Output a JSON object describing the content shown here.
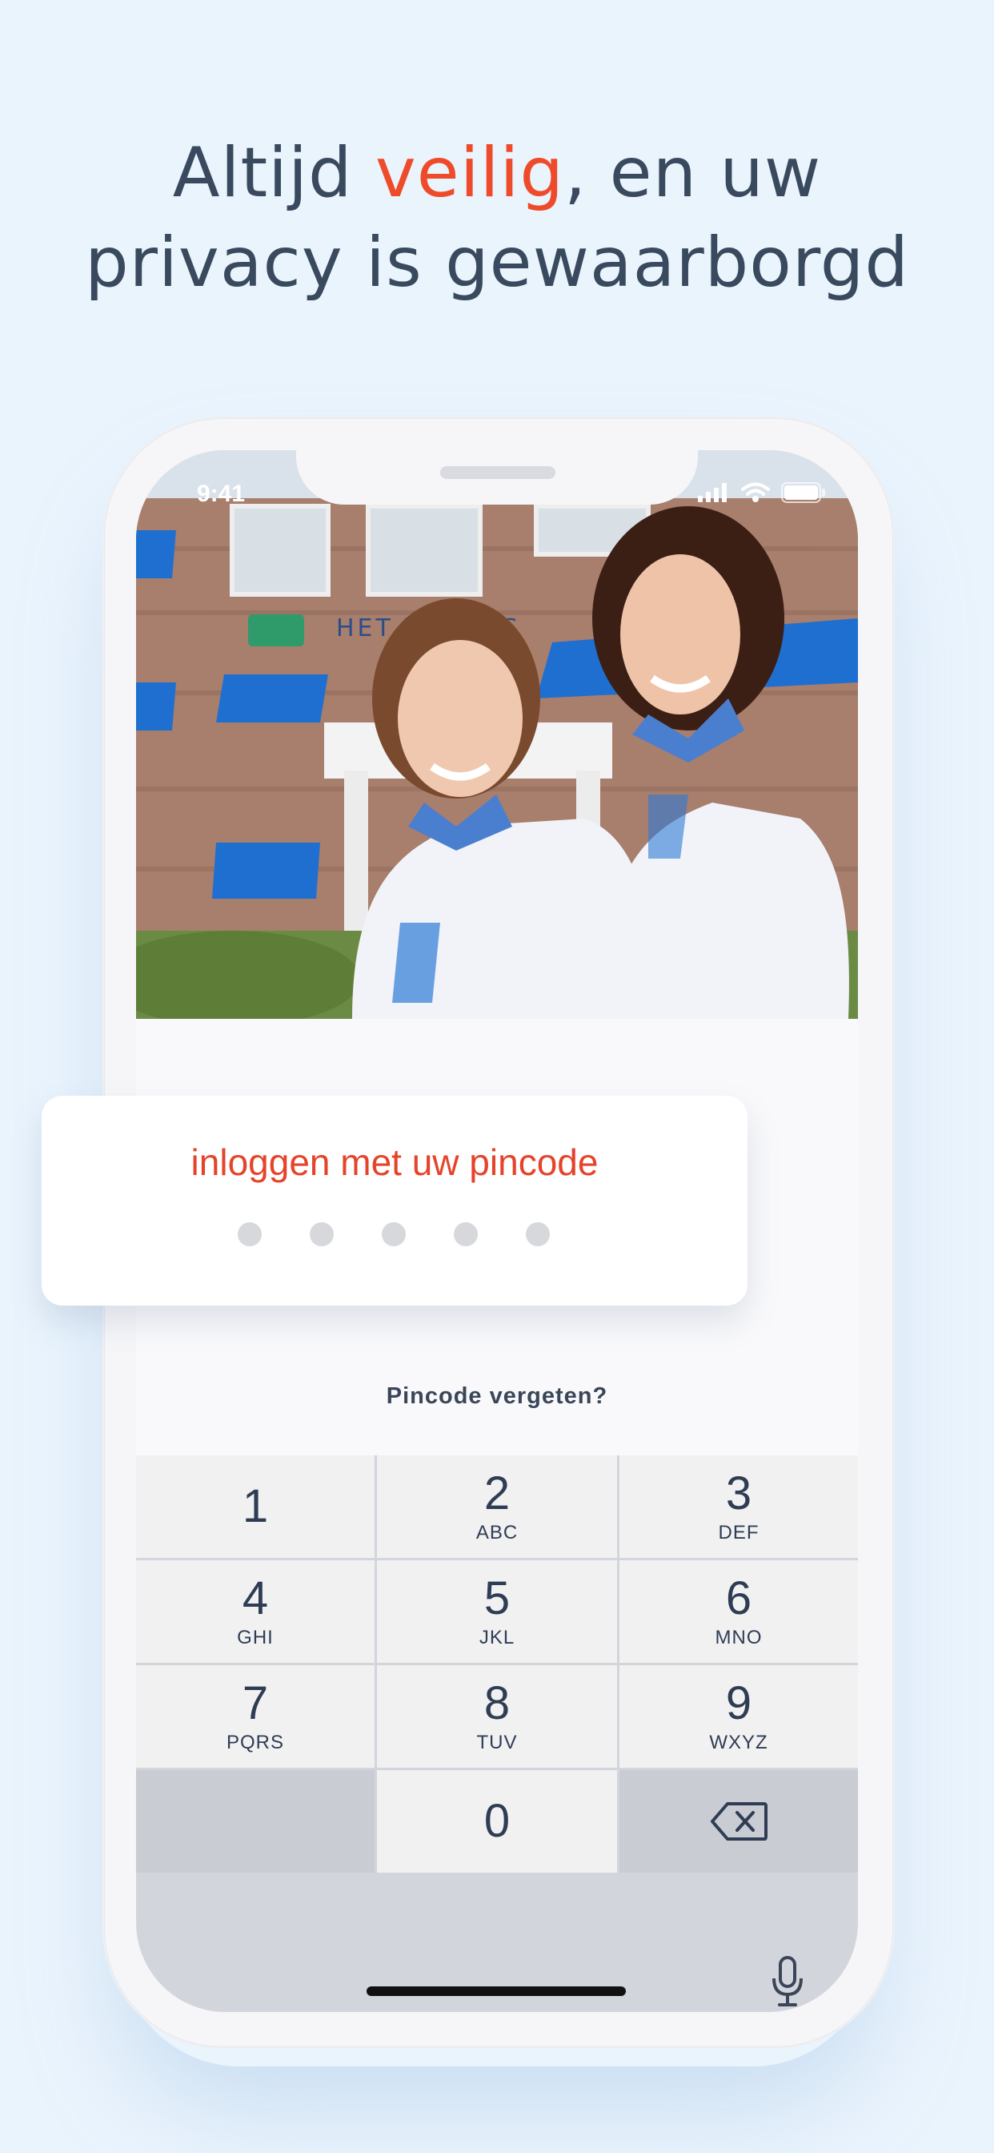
{
  "headline": {
    "part1": "Altijd ",
    "accent": "veilig",
    "part2": ", en uw",
    "line2": "privacy is gewaarborgd"
  },
  "status_bar": {
    "time": "9:41"
  },
  "pin_card": {
    "title": "inloggen met uw pincode",
    "dots_filled": 0,
    "dots_total": 5
  },
  "forgot_link": "Pincode vergeten?",
  "keypad": {
    "keys": [
      {
        "digit": "1",
        "letters": ""
      },
      {
        "digit": "2",
        "letters": "ABC"
      },
      {
        "digit": "3",
        "letters": "DEF"
      },
      {
        "digit": "4",
        "letters": "GHI"
      },
      {
        "digit": "5",
        "letters": "JKL"
      },
      {
        "digit": "6",
        "letters": "MNO"
      },
      {
        "digit": "7",
        "letters": "PQRS"
      },
      {
        "digit": "8",
        "letters": "TUV"
      },
      {
        "digit": "9",
        "letters": "WXYZ"
      },
      {
        "digit": "0",
        "letters": ""
      }
    ]
  },
  "icons": [
    "signal-icon",
    "wifi-icon",
    "battery-icon",
    "backspace-icon",
    "microphone-icon"
  ],
  "colors": {
    "accent": "#ee4b2b",
    "text": "#3a4a5e",
    "background": "#eaf4fd"
  }
}
